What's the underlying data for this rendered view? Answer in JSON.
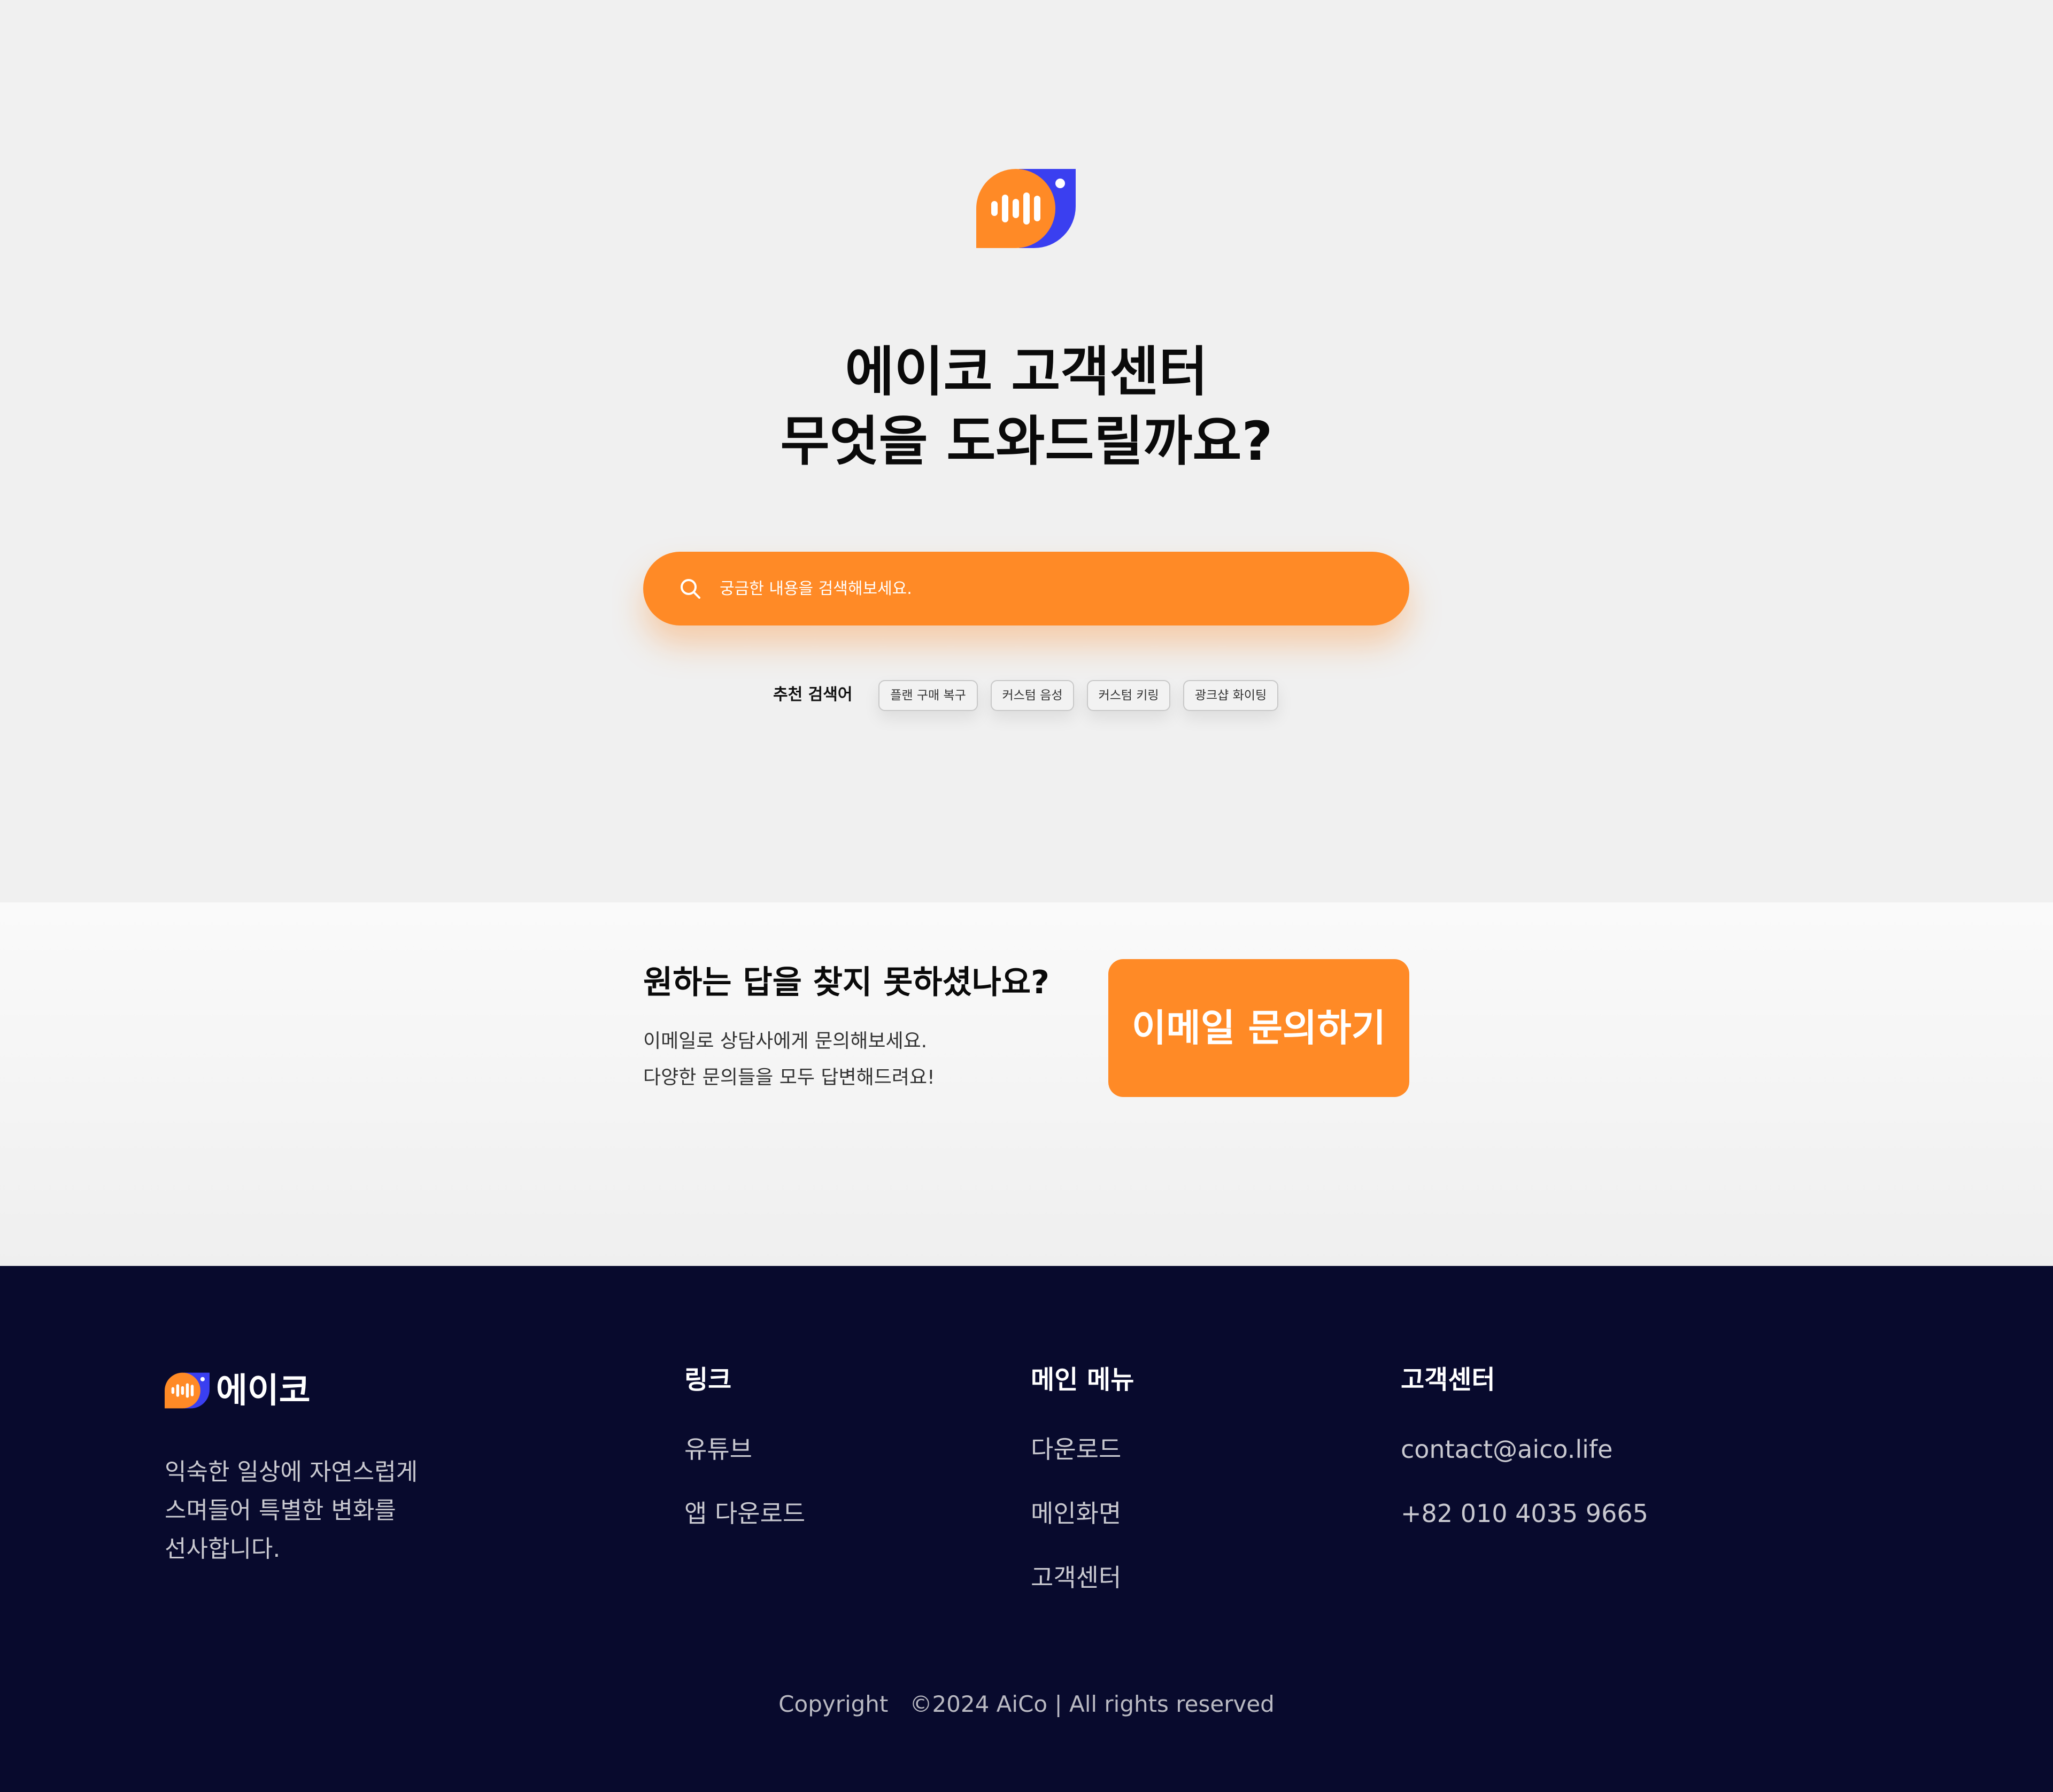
{
  "hero": {
    "title_line1": "에이코 고객센터",
    "title_line2": "무엇을 도와드릴까요?",
    "search_placeholder": "궁금한 내용을 검색해보세요.",
    "recommended_label": "추천 검색어",
    "recommended_chips": [
      "플랜 구매 복구",
      "커스텀 음성",
      "커스텀 키링",
      "광크샵 화이팅"
    ]
  },
  "contact": {
    "title": "원하는 답을 찾지 못하셨나요?",
    "desc_line1": "이메일로 상담사에게 문의해보세요.",
    "desc_line2": "다양한 문의들을 모두 답변해드려요!",
    "button_label": "이메일 문의하기"
  },
  "footer": {
    "brand": "에이코",
    "description": [
      "익숙한 일상에 자연스럽게",
      "스며들어 특별한 변화를",
      "선사합니다."
    ],
    "columns": [
      {
        "heading": "링크",
        "items": [
          "유튜브",
          "앱 다운로드"
        ]
      },
      {
        "heading": "메인 메뉴",
        "items": [
          "다운로드",
          "메인화면",
          "고객센터"
        ]
      },
      {
        "heading": "고객센터",
        "items": [
          "contact@aico.life",
          "+82 010 4035 9665"
        ]
      }
    ],
    "copyright": "Copyright   ©2024 AiCo | All rights reserved"
  },
  "colors": {
    "accent_orange": "#ff8a26",
    "accent_blue": "#3a3ff0",
    "footer_bg": "#080a2d",
    "hero_bg": "#f0f0f0"
  },
  "icons": [
    "brand-logo-icon",
    "search-icon"
  ]
}
